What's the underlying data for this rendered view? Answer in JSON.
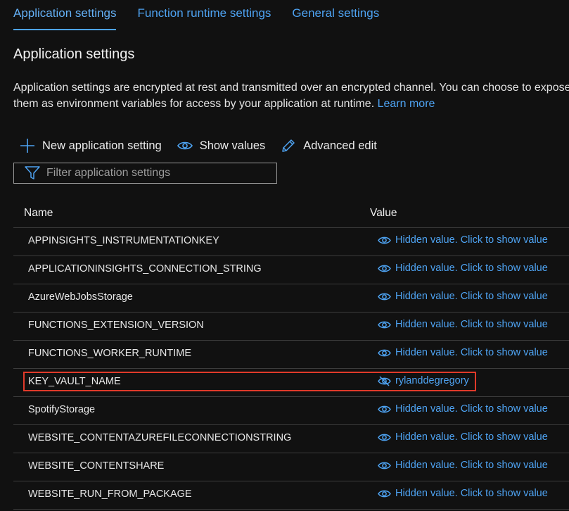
{
  "tabs": [
    {
      "label": "Application settings",
      "active": true
    },
    {
      "label": "Function runtime settings",
      "active": false
    },
    {
      "label": "General settings",
      "active": false
    }
  ],
  "section": {
    "title": "Application settings",
    "description": "Application settings are encrypted at rest and transmitted over an encrypted channel. You can choose to expose them as environment variables for access by your application at runtime.",
    "learn_more": "Learn more"
  },
  "toolbar": {
    "new_label": "New application setting",
    "show_values_label": "Show values",
    "advanced_edit_label": "Advanced edit"
  },
  "filter": {
    "placeholder": "Filter application settings",
    "value": ""
  },
  "table": {
    "headers": {
      "name": "Name",
      "value": "Value"
    },
    "rows": [
      {
        "name": "APPINSIGHTS_INSTRUMENTATIONKEY",
        "value": "Hidden value. Click to show value",
        "icon": "eye-icon"
      },
      {
        "name": "APPLICATIONINSIGHTS_CONNECTION_STRING",
        "value": "Hidden value. Click to show value",
        "icon": "eye-icon"
      },
      {
        "name": "AzureWebJobsStorage",
        "value": "Hidden value. Click to show value",
        "icon": "eye-icon"
      },
      {
        "name": "FUNCTIONS_EXTENSION_VERSION",
        "value": "Hidden value. Click to show value",
        "icon": "eye-icon"
      },
      {
        "name": "FUNCTIONS_WORKER_RUNTIME",
        "value": "Hidden value. Click to show value",
        "icon": "eye-icon"
      },
      {
        "name": "KEY_VAULT_NAME",
        "value": "rylanddegregory",
        "icon": "eye-slash-icon"
      },
      {
        "name": "SpotifyStorage",
        "value": "Hidden value. Click to show value",
        "icon": "eye-icon"
      },
      {
        "name": "WEBSITE_CONTENTAZUREFILECONNECTIONSTRING",
        "value": "Hidden value. Click to show value",
        "icon": "eye-icon"
      },
      {
        "name": "WEBSITE_CONTENTSHARE",
        "value": "Hidden value. Click to show value",
        "icon": "eye-icon"
      },
      {
        "name": "WEBSITE_RUN_FROM_PACKAGE",
        "value": "Hidden value. Click to show value",
        "icon": "eye-icon"
      }
    ]
  },
  "colors": {
    "background": "#111111",
    "accent": "#4ea3f2",
    "highlight": "#e03a2a",
    "divider": "#3c3c3c"
  }
}
